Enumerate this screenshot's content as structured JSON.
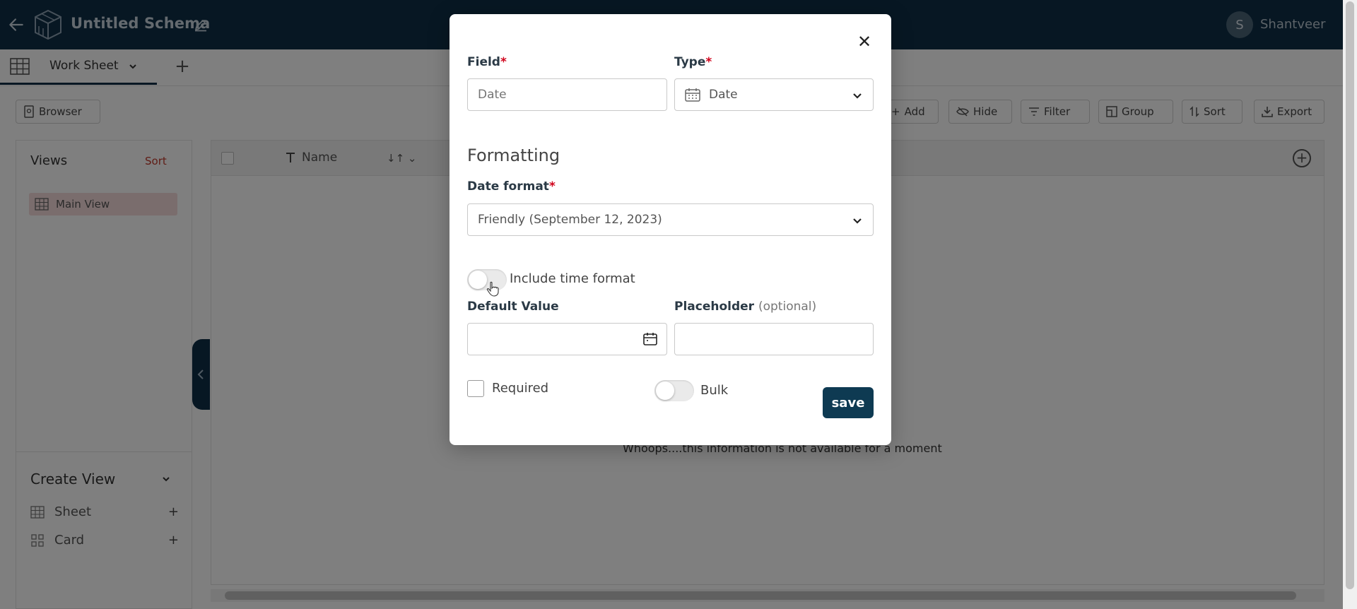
{
  "header": {
    "schema_title": "Untitled Schema",
    "avatar_initial": "S",
    "username": "Shantveer"
  },
  "tabs": {
    "active_label": "Work Sheet"
  },
  "toolbar": {
    "browser_label": "Browser",
    "add_label": "Add",
    "hide_label": "Hide",
    "filter_label": "Filter",
    "group_label": "Group",
    "sort_label": "Sort",
    "export_label": "Export"
  },
  "sidebar": {
    "views_title": "Views",
    "views_sort": "Sort",
    "main_view": "Main View",
    "create_view_title": "Create View",
    "create_items": [
      "Sheet",
      "Card"
    ]
  },
  "grid": {
    "name_column": "Name",
    "empty_message": "Whoops....this information is not available for a moment"
  },
  "modal": {
    "field_label": "Field",
    "field_placeholder": "Date",
    "type_label": "Type",
    "type_value": "Date",
    "formatting_title": "Formatting",
    "date_format_label": "Date format",
    "date_format_value": "Friendly (September 12, 2023)",
    "include_time_label": "Include time format",
    "include_time_on": false,
    "default_value_label": "Default Value",
    "placeholder_label": "Placeholder",
    "placeholder_optional": "(optional)",
    "required_label": "Required",
    "bulk_label": "Bulk",
    "bulk_on": false,
    "save_label": "save",
    "required_asterisk": "*"
  },
  "colors": {
    "header_bg": "#0e2f47",
    "accent": "#0e3a52",
    "required_red": "#d0021b"
  }
}
